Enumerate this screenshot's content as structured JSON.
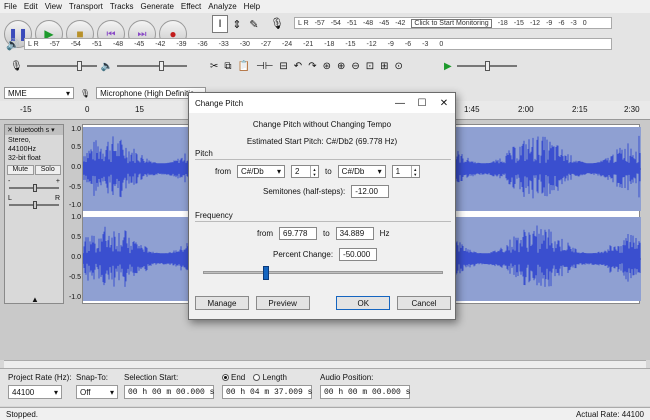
{
  "menu": [
    "File",
    "Edit",
    "View",
    "Transport",
    "Tracks",
    "Generate",
    "Effect",
    "Analyze",
    "Help"
  ],
  "meters": {
    "record_channels": "L R",
    "record_ticks": [
      "-57",
      "-54",
      "-51",
      "-48",
      "-45",
      "-42"
    ],
    "record_ticks_right": [
      "-18",
      "-15",
      "-12",
      "-9",
      "-6",
      "-3",
      "0"
    ],
    "monitor_tip": "Click to Start Monitoring",
    "play_channels": "L R",
    "play_ticks": [
      "-57",
      "-54",
      "-51",
      "-48",
      "-45",
      "-42",
      "-39",
      "-36",
      "-33",
      "-30",
      "-27",
      "-24",
      "-21",
      "-18",
      "-15",
      "-12",
      "-9",
      "-6",
      "-3",
      "0"
    ]
  },
  "devices": {
    "host": "MME",
    "mic": "Microphone (High Definitic"
  },
  "ruler": {
    "ticks": [
      "-15",
      "0",
      "15",
      "1:45",
      "2:00",
      "2:15",
      "2:30"
    ]
  },
  "track": {
    "name": "bluetooth s",
    "rate": "Stereo, 44100Hz",
    "format": "32-bit float",
    "mute": "Mute",
    "solo": "Solo",
    "gain_left": "-",
    "gain_right": "+",
    "pan_left": "L",
    "pan_right": "R",
    "collapse": "▲",
    "scale": [
      "1.0",
      "0.5",
      "0.0",
      "-0.5",
      "-1.0",
      "1.0",
      "0.5",
      "0.0",
      "-0.5",
      "-1.0"
    ]
  },
  "selection_toolbar": {
    "project_rate_label": "Project Rate (Hz):",
    "project_rate": "44100",
    "snap_label": "Snap-To:",
    "snap_value": "Off",
    "sel_start_label": "Selection Start:",
    "sel_start": "00 h 00 m 00.000 s",
    "end_label": "End",
    "length_label": "Length",
    "sel_end": "00 h 04 m 37.009 s",
    "audio_pos_label": "Audio Position:",
    "audio_pos": "00 h 00 m 00.000 s"
  },
  "status": {
    "left": "Stopped.",
    "right": "Actual Rate: 44100"
  },
  "dialog": {
    "title": "Change Pitch",
    "heading": "Change Pitch without Changing Tempo",
    "estimated": "Estimated Start Pitch: C#/Db2 (69.778 Hz)",
    "pitch_group": "Pitch",
    "from_label": "from",
    "from_note": "C#/Db",
    "from_octave": "2",
    "to_label": "to",
    "to_note": "C#/Db",
    "to_octave": "1",
    "semitones_label": "Semitones (half-steps):",
    "semitones": "-12.00",
    "freq_group": "Frequency",
    "freq_from_label": "from",
    "freq_from": "69.778",
    "freq_to_label": "to",
    "freq_to": "34.889",
    "freq_unit": "Hz",
    "percent_label": "Percent Change:",
    "percent": "-50.000",
    "slider_fraction": 0.25,
    "manage": "Manage",
    "preview": "Preview",
    "ok": "OK",
    "cancel": "Cancel"
  }
}
